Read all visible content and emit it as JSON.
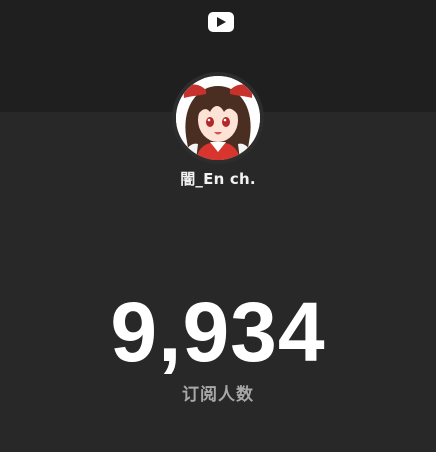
{
  "header": {
    "logo_icon": "youtube-play-icon"
  },
  "channel": {
    "name": "闇_En ch.",
    "avatar_icon": "anime-girl-avatar"
  },
  "stats": {
    "subscriber_count": "9,934",
    "subscriber_label": "订阅人数"
  },
  "colors": {
    "background": "#282828",
    "header_band": "#1f1f1f",
    "text_primary": "#ffffff",
    "text_secondary": "#a8a8a8"
  }
}
